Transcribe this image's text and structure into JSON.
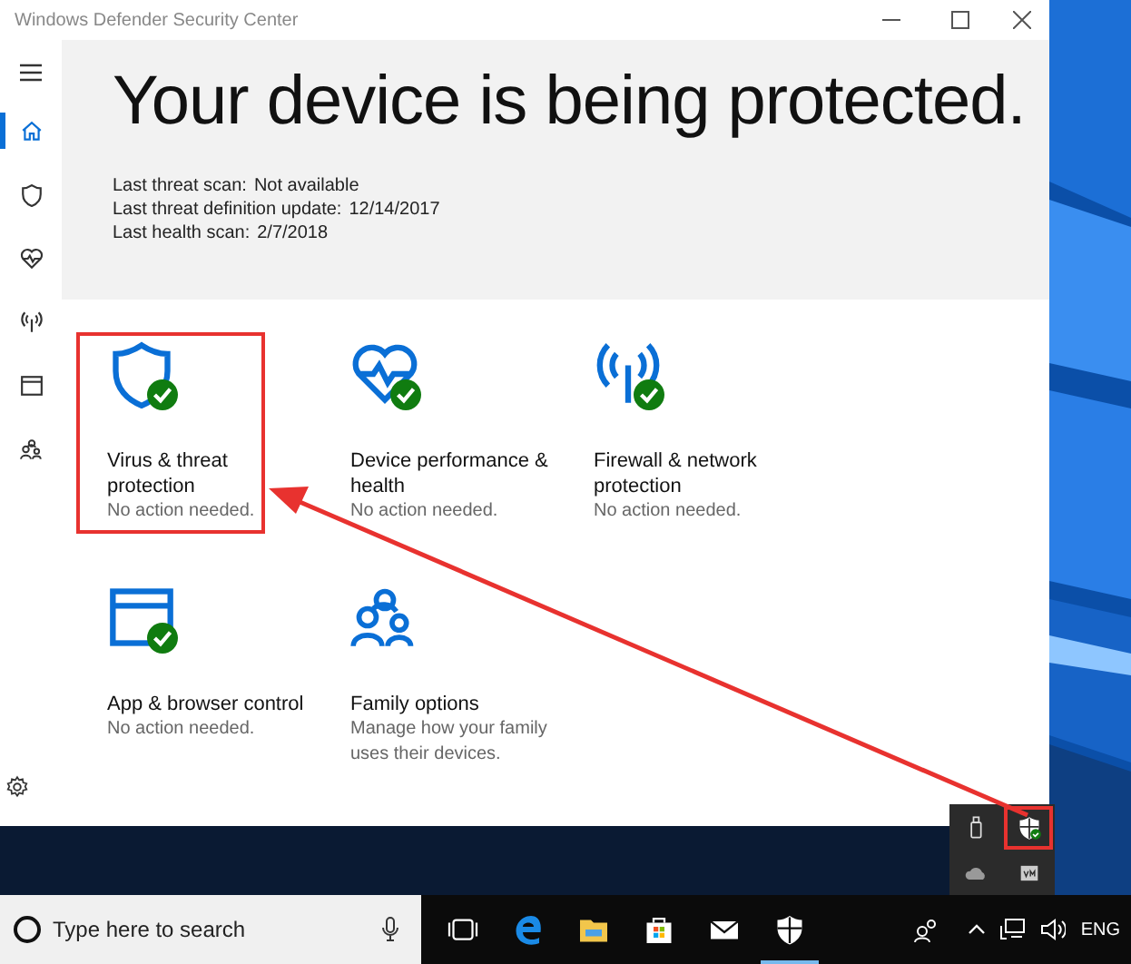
{
  "window": {
    "title": "Windows Defender Security Center"
  },
  "nav": [
    {
      "kind": "home",
      "selected": true
    },
    {
      "kind": "shield",
      "selected": false
    },
    {
      "kind": "heart",
      "selected": false
    },
    {
      "kind": "antenna",
      "selected": false
    },
    {
      "kind": "browser",
      "selected": false
    },
    {
      "kind": "family",
      "selected": false
    }
  ],
  "header": {
    "title": "Your device is being protected.",
    "lines": [
      {
        "label": "Last threat scan:",
        "value": "Not available"
      },
      {
        "label": "Last threat definition update:",
        "value": "12/14/2017"
      },
      {
        "label": "Last health scan:",
        "value": "2/7/2018"
      }
    ]
  },
  "tiles": [
    {
      "kind": "shield",
      "title": "Virus & threat protection",
      "subtitle": "No action needed.",
      "ok": true,
      "highlighted": true
    },
    {
      "kind": "heart",
      "title": "Device performance & health",
      "subtitle": "No action needed.",
      "ok": true,
      "highlighted": false
    },
    {
      "kind": "antenna",
      "title": "Firewall & network protection",
      "subtitle": "No action needed.",
      "ok": true,
      "highlighted": false
    },
    {
      "kind": "browser",
      "title": "App & browser control",
      "subtitle": "No action needed.",
      "ok": true,
      "highlighted": false
    },
    {
      "kind": "family",
      "title": "Family options",
      "subtitle": "Manage how your family uses their devices.",
      "ok": false,
      "highlighted": false
    }
  ],
  "taskbar": {
    "search": {
      "placeholder": "Type here to search"
    },
    "apps": [
      {
        "kind": "taskview",
        "selected": false
      },
      {
        "kind": "edge",
        "selected": false
      },
      {
        "kind": "folder",
        "selected": false
      },
      {
        "kind": "store",
        "selected": false
      },
      {
        "kind": "mail",
        "selected": false
      },
      {
        "kind": "defender",
        "selected": true
      }
    ],
    "language": "ENG"
  },
  "tray_popup": {
    "items": [
      {
        "kind": "usb",
        "highlighted": false
      },
      {
        "kind": "defender",
        "highlighted": true
      },
      {
        "kind": "cloud",
        "highlighted": false
      },
      {
        "kind": "vm",
        "highlighted": false
      }
    ]
  }
}
